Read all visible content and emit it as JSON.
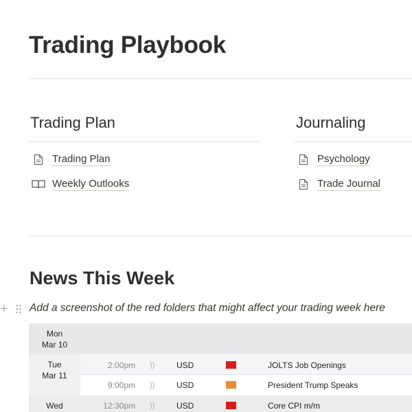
{
  "page": {
    "title": "Trading Playbook"
  },
  "columns": [
    {
      "heading": "Trading Plan",
      "items": [
        {
          "label": "Trading Plan",
          "icon": "page-icon"
        },
        {
          "label": "Weekly Outlooks",
          "icon": "book-icon"
        }
      ]
    },
    {
      "heading": "Journaling",
      "items": [
        {
          "label": "Psychology",
          "icon": "page-icon"
        },
        {
          "label": "Trade Journal",
          "icon": "page-icon"
        }
      ]
    }
  ],
  "news": {
    "title": "News This Week",
    "note": "Add a screenshot of the red folders that might affect your trading week here"
  },
  "calendar": {
    "days": [
      {
        "dow": "Mon",
        "date": "Mar 10"
      },
      {
        "dow": "Tue",
        "date": "Mar 11"
      },
      {
        "dow": "Wed",
        "date": ""
      }
    ],
    "events": [
      {
        "time": "2:00pm",
        "currency": "USD",
        "impact": "high",
        "impact_color": "#d51e1e",
        "name": "JOLTS Job Openings"
      },
      {
        "time": "9:00pm",
        "currency": "USD",
        "impact": "medium",
        "impact_color": "#ec8c3c",
        "name": "President Trump Speaks"
      },
      {
        "time": "12:30pm",
        "currency": "USD",
        "impact": "high",
        "impact_color": "#d51e1e",
        "name": "Core CPI m/m"
      }
    ],
    "colors": {
      "header_bg": "#e8e8ea",
      "row_alt_bg": "#f4f4f6",
      "row_bg": "#ffffff",
      "day_bg": "#ececee"
    }
  }
}
